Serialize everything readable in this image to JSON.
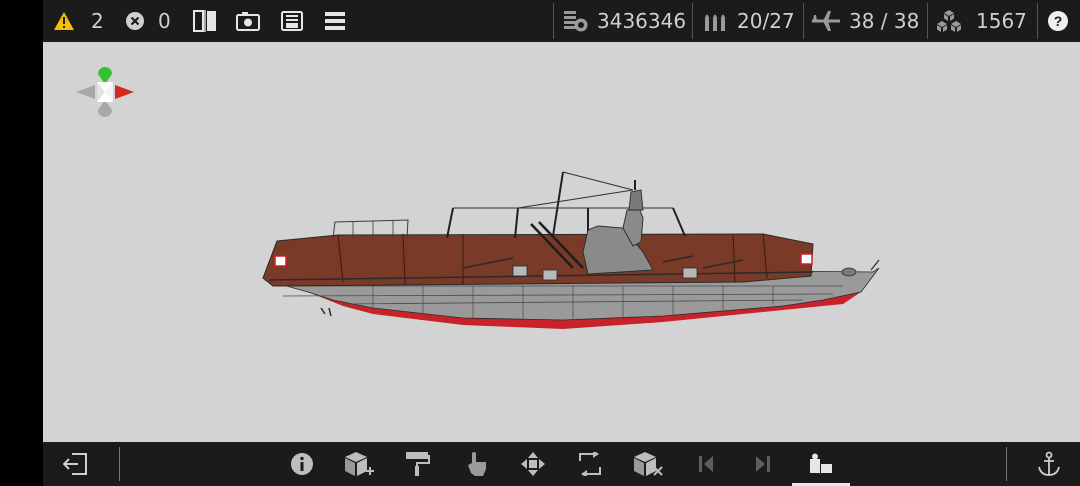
{
  "topbar": {
    "warnings": "2",
    "errors": "0",
    "cost": "3436346",
    "ammo": "20/27",
    "aircraft": "38 / 38",
    "blocks": "1567",
    "icons": [
      "warning-icon",
      "error-icon",
      "mirror-icon",
      "camera-icon",
      "save-icon",
      "menu-icon",
      "cost-icon",
      "ammo-icon",
      "aircraft-icon",
      "blocks-icon",
      "help-icon"
    ]
  },
  "bottombar": {
    "icons": [
      "exit-icon",
      "info-icon",
      "add-block-icon",
      "paint-icon",
      "select-icon",
      "move-icon",
      "rotate-icon",
      "delete-block-icon",
      "prev-icon",
      "next-icon",
      "workshop-icon",
      "anchor-icon"
    ],
    "active": "workshop-icon"
  },
  "colors": {
    "bar_bg": "#1b1b1b",
    "viewport_bg": "#d3d3d3",
    "deck": "#7a3a28",
    "hull": "#9a9a9a",
    "waterline": "#c8232b",
    "warning": "#f2c200",
    "gizmo_y": "#33c233",
    "gizmo_x": "#d42a1c"
  }
}
